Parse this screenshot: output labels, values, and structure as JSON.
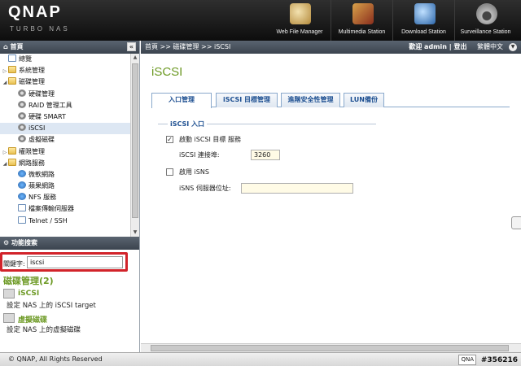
{
  "header": {
    "logo": "QNAP",
    "logo_sub": "TURBO NAS",
    "apps": [
      {
        "label": "Web File Manager",
        "icon": "web-file-manager-icon",
        "color": "#c8a55a"
      },
      {
        "label": "Multimedia Station",
        "icon": "multimedia-station-icon",
        "color": "#b04a2a"
      },
      {
        "label": "Download Station",
        "icon": "download-station-icon",
        "color": "#3a7cc4"
      },
      {
        "label": "Surveillance Station",
        "icon": "surveillance-station-icon",
        "color": "#888888"
      }
    ]
  },
  "left": {
    "title": "首頁",
    "tree": [
      {
        "label": "總覽",
        "level": 0,
        "expand": "",
        "icon": "doc"
      },
      {
        "label": "系統管理",
        "level": 0,
        "expand": "▷",
        "icon": "folder"
      },
      {
        "label": "磁碟管理",
        "level": 0,
        "expand": "◢",
        "icon": "folder"
      },
      {
        "label": "硬碟管理",
        "level": 1,
        "expand": "",
        "icon": "gear"
      },
      {
        "label": "RAID 管理工具",
        "level": 1,
        "expand": "",
        "icon": "gear"
      },
      {
        "label": "硬碟 SMART",
        "level": 1,
        "expand": "",
        "icon": "gear"
      },
      {
        "label": "iSCSI",
        "level": 1,
        "expand": "",
        "icon": "gear",
        "selected": true
      },
      {
        "label": "虛擬磁碟",
        "level": 1,
        "expand": "",
        "icon": "gear"
      },
      {
        "label": "權限管理",
        "level": 0,
        "expand": "▷",
        "icon": "folder"
      },
      {
        "label": "網路服務",
        "level": 0,
        "expand": "◢",
        "icon": "folder"
      },
      {
        "label": "微軟網路",
        "level": 1,
        "expand": "",
        "icon": "net"
      },
      {
        "label": "蘋果網路",
        "level": 1,
        "expand": "",
        "icon": "net"
      },
      {
        "label": "NFS 服務",
        "level": 1,
        "expand": "",
        "icon": "net"
      },
      {
        "label": "檔案傳輸伺服器",
        "level": 1,
        "expand": "",
        "icon": "doc"
      },
      {
        "label": "Telnet / SSH",
        "level": 1,
        "expand": "",
        "icon": "doc"
      }
    ],
    "search": {
      "title": "功能搜索",
      "keyword_label": "關鍵字:",
      "keyword_value": "iscsi",
      "result_header": "磁碟管理(2)",
      "results": [
        {
          "title": "iSCSI",
          "desc": "設定 NAS 上的 iSCSI target"
        },
        {
          "title": "虛擬磁碟",
          "desc": "設定 NAS 上的虛擬磁碟"
        }
      ]
    }
  },
  "right": {
    "breadcrumb": "首頁 >> 磁碟管理 >> iSCSI",
    "welcome": "歡迎 admin | 登出",
    "language": "繁體中文",
    "page_title": "iSCSI",
    "tabs": [
      "入口管理",
      "iSCSI 目標管理",
      "進階安全性管理",
      "LUN備份"
    ],
    "section_title": "iSCSI 入口",
    "enable_target_label": "啟動 iSCSI 目標 服務",
    "enable_target_checked": "✓",
    "port_label": "iSCSI 連接埠:",
    "port_value": "3260",
    "enable_isns_label": "啟用 iSNS",
    "isns_server_label": "iSNS 伺服器位址:",
    "isns_server_value": ""
  },
  "footer": {
    "copyright": "© QNAP, All Rights Reserved",
    "qna": "QNA",
    "watermark": "#356216"
  }
}
